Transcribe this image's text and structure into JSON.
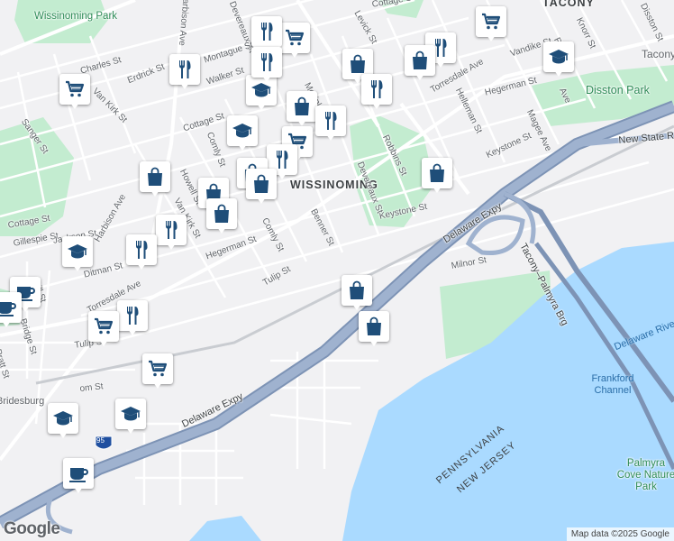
{
  "map": {
    "attribution": "Map data ©2025 Google",
    "logo": "Google",
    "labels": {
      "wissinoming_park": "Wissinoming Park",
      "tacony": "TACONY",
      "tacony2": "Tacony",
      "disston_park": "Disston Park",
      "wissinoming": "WISSINOMING",
      "new_state_rd": "New State R",
      "delaware_expy_1": "Delaware Expy",
      "delaware_expy_2": "Delaware Expy",
      "tacony_palmyra_brg": "Tacony–Palmyra Brg",
      "delaware_river": "Delaware Rive",
      "frankford_channel": "Frankford Channel",
      "pennsylvania": "PENNSYLVANIA",
      "new_jersey": "NEW JERSEY",
      "palmyra_cove": "Palmyra Cove Nature Park",
      "bridesburg": "Bridesburg",
      "i95": "95",
      "milnor_st": "Milnor St",
      "keystone_st_1": "Keystone St",
      "keystone_st_2": "Keystone St",
      "devereaux_st_1": "Devereaux St",
      "devereaux_st_2": "Devereaux St",
      "robbins_st": "Robbins St",
      "benner_st": "Benner St",
      "comly_st_1": "Comly St",
      "comly_st_2": "Comly St",
      "tulip_st_1": "Tulip St",
      "tulip_st_2": "Tulip St",
      "hegerman_st_1": "Hegerman St",
      "hegerman_st_2": "Hegerman St",
      "howell_st": "Howell St",
      "cottage_st_1": "Cottage St",
      "cottage_st_2": "Cottage St",
      "cottage_st_3": "Cottage St",
      "walker_st": "Walker St",
      "montague_st": "Montague St",
      "erdrick_st": "Erdrick St",
      "van_kirk_st_1": "Van Kirk St",
      "van_kirk_st_2": "Van Kirk St",
      "sanger_st": "Sanger St",
      "charles_st": "Charles St",
      "gillespie_st": "Gillespie St",
      "jackson_st": "Jackson St",
      "ditman_st": "Ditman St",
      "torresdale_ave_1": "Torresdale Ave",
      "torresdale_ave_2": "Torresdale Ave",
      "harbison_ave_1": "Harbison Ave",
      "harbison_ave_2": "Harbison Ave",
      "levick_st": "Levick St",
      "mckinley_st": "Mckinley St",
      "helleman_st": "Helleman St",
      "vandike_st": "Vandike St",
      "magee_ave": "Magee Ave",
      "knorr_st": "Knorr St",
      "disston_st": "Disston St",
      "pratt_st": "Pratt St",
      "bridge_st": "Bridge St",
      "brill_st": "Brill St",
      "orthodox_st": "om St",
      "ave_partial": "Ave",
      "ra_partial": "Ra"
    },
    "pin_icons": {
      "cart": "shopping-cart-icon",
      "food": "restaurant-icon",
      "bag": "shopping-bag-icon",
      "school": "school-icon",
      "coffee": "coffee-cup-icon"
    },
    "colors": {
      "land": "#f1f1f3",
      "water": "#aadaff",
      "park": "#c3ecd0",
      "highway": "#8fa4c4",
      "pin_icon": "#1f4e79"
    }
  }
}
